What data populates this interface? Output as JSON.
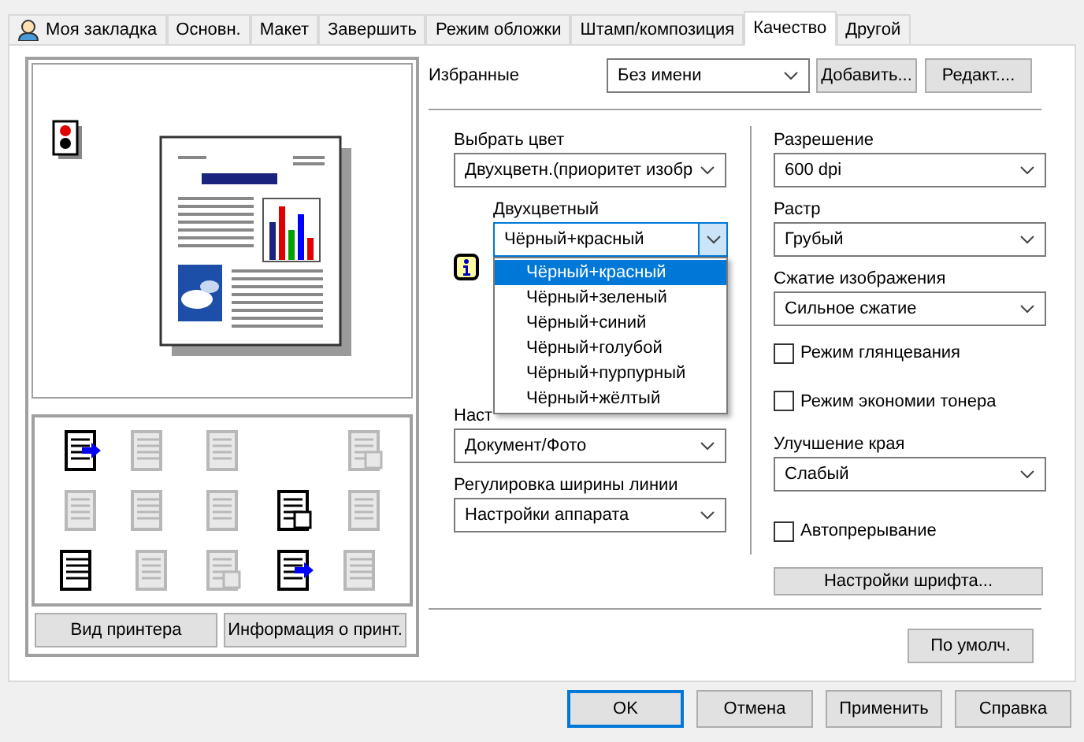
{
  "tabs": [
    {
      "label": "Моя закладка",
      "kind": "with_icon",
      "selected": false
    },
    {
      "label": "Основн.",
      "kind": "plain",
      "selected": false
    },
    {
      "label": "Макет",
      "kind": "plain",
      "selected": false
    },
    {
      "label": "Завершить",
      "kind": "plain",
      "selected": false
    },
    {
      "label": "Режим обложки",
      "kind": "plain",
      "selected": false
    },
    {
      "label": "Штамп/композиция",
      "kind": "plain",
      "selected": false
    },
    {
      "label": "Качество",
      "kind": "plain",
      "selected": true
    },
    {
      "label": "Другой",
      "kind": "plain",
      "selected": false
    }
  ],
  "preview": {
    "buttons": [
      "Вид принтера",
      "Информация о принт."
    ],
    "function_icons": [
      {
        "disabled": false
      },
      {
        "disabled": true
      },
      {
        "disabled": true
      },
      {
        "disabled": true
      },
      {
        "disabled": true
      },
      {
        "disabled": true
      },
      {
        "disabled": true
      },
      {
        "disabled": false
      },
      {
        "disabled": true
      },
      {
        "disabled": false
      },
      {
        "disabled": true
      },
      {
        "disabled": true
      },
      {
        "disabled": false
      },
      {
        "disabled": true
      }
    ]
  },
  "favorites": {
    "label": "Избранные",
    "value": "Без имени",
    "buttons": [
      "Добавить...",
      "Редакт...."
    ]
  },
  "color": {
    "label": "Выбрать цвет",
    "value": "Двухцветн.(приоритет изобр",
    "two_color_label": "Двухцветный",
    "two_color_value": "Чёрный+красный",
    "options": [
      {
        "label": "Чёрный+красный",
        "selected": true
      },
      {
        "label": "Чёрный+зеленый",
        "selected": false
      },
      {
        "label": "Чёрный+синий",
        "selected": false
      },
      {
        "label": "Чёрный+голубой",
        "selected": false
      },
      {
        "label": "Чёрный+пурпурный",
        "selected": false
      },
      {
        "label": "Чёрный+жёлтый",
        "selected": false
      }
    ]
  },
  "setting": {
    "label": "Наст",
    "value": "Документ/Фото"
  },
  "line_width": {
    "label": "Регулировка ширины линии",
    "value": "Настройки аппарата"
  },
  "resolution": {
    "label": "Разрешение",
    "value": "600 dpi"
  },
  "screen": {
    "label": "Растр",
    "value": "Грубый"
  },
  "compression": {
    "label": "Сжатие изображения",
    "value": "Сильное сжатие"
  },
  "glossy": {
    "label": "Режим глянцевания",
    "checked": false
  },
  "toner_save": {
    "label": "Режим экономии тонера",
    "checked": false
  },
  "edge": {
    "label": "Улучшение края",
    "value": "Слабый"
  },
  "auto_trapping": {
    "label": "Автопрерывание",
    "checked": false
  },
  "font_settings_button": "Настройки шрифта...",
  "default_button": "По умолч.",
  "dialog_buttons": [
    "OK",
    "Отмена",
    "Применить",
    "Справка"
  ]
}
